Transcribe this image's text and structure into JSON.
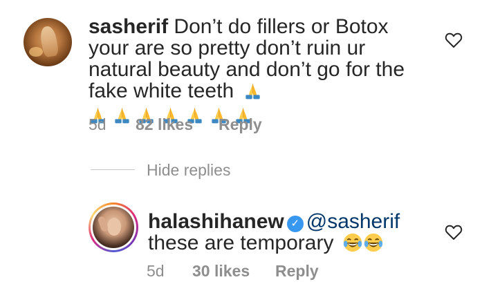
{
  "comments": [
    {
      "username": "sasherif",
      "text": "Don’t do fillers or Botox your are so pretty don’t ruin ur natural beauty and don’t go for the fake white teeth",
      "emoji_trail": "folded-hands-emoji",
      "emoji_row_count": 7,
      "time": "5d",
      "likes": "82 likes",
      "reply_label": "Reply"
    }
  ],
  "hide_replies_label": "Hide replies",
  "replies": [
    {
      "username": "halashihanew",
      "verified": true,
      "mention": "@sasherif",
      "text": "these are temporary",
      "emoji_trail": "face-with-tears-of-joy-emoji x2",
      "time": "5d",
      "likes": "30 likes",
      "reply_label": "Reply"
    }
  ],
  "colors": {
    "text": "#262626",
    "muted": "#8e8e8e",
    "mention": "#00376b",
    "verified": "#3897f0"
  }
}
